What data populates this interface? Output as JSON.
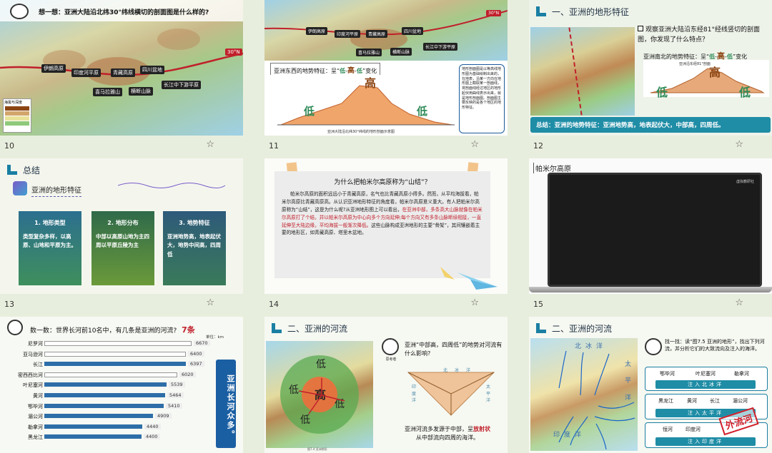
{
  "slides": [
    {
      "num": "10",
      "title": "想一想：亚洲大陆沿北纬30°纬线横切的剖面图是什么样的?",
      "lat": "30°N",
      "labels": [
        "伊朗高原",
        "印度河平原",
        "青藏高原",
        "四川盆地",
        "喜马拉雅山",
        "横断山脉",
        "长江中下游平原"
      ],
      "legend_title": "海拔与深度"
    },
    {
      "num": "11",
      "lat": "30°N",
      "labels": [
        "伊朗高原",
        "印度河平原",
        "青藏高原",
        "四川盆地",
        "喜马拉雅山",
        "横断山脉",
        "长江中下游平原"
      ],
      "feature_prefix": "亚洲东西的地势特征：呈“",
      "feature_low1": "低",
      "feature_mid": "高",
      "feature_low2": "低",
      "feature_suffix": "”变化",
      "profile_high": "高",
      "profile_low_left": "低",
      "profile_low_right": "低",
      "caption": "亚洲大陆沿北纬30°纬线的地形剖面示意图",
      "note": "地形剖面图是以等高线地形图为基础绘制出来的，在地表，沿某一方向在地形图上截取某一剖面线，将剖面线经过地区的地形起伏用曲线表示出来，就是地形剖面图。剖面图主要反映的是各个地区的地形特征。"
    },
    {
      "num": "12",
      "section": "一、亚洲的地形特征",
      "question": "观察亚洲大陆沿东经81°经线竖切的剖面图，你发现了什么特点？",
      "feature_prefix": "亚洲南北的地势特征：呈“",
      "feature_low1": "低",
      "feature_mid": "高",
      "feature_low2": "低",
      "feature_suffix": "”变化",
      "profile_title": "亚洲沿东经81°剖面",
      "profile_high": "高",
      "profile_low_left": "低",
      "profile_low_right": "低",
      "summary": "总结：亚洲的地势特征：亚洲地势高，地表起伏大，中部高，四周低。"
    },
    {
      "num": "13",
      "section": "总结",
      "subtitle": "亚洲的地形特征",
      "cards": [
        {
          "title": "1. 地形类型",
          "body": "类型复杂多样，以高原、山地和平原为主。"
        },
        {
          "title": "2. 地形分布",
          "body": "中部以高原山地为主四周以平原丘陵为主"
        },
        {
          "title": "3. 地势特征",
          "body": "亚洲地势高，地表起伏大，地势中间高，四周低"
        }
      ]
    },
    {
      "num": "14",
      "title": "为什么把帕米尔高原称为“山结”？",
      "para1": "帕米尔高原的面积远远小于青藏高原，名气也比青藏高原小得多。然而，从平均海拔看，帕米尔高原比青藏高原高。从认识亚洲地形特征的角度看，帕米尔高原意义重大。有人把帕米尔高原称为“山结”，这是为什么呢?从亚洲地形图上可以看出，",
      "para_red": "在亚洲中部，多条高大山脉就像在帕米尔高原打了个结，并以帕米尔高原为中心向多个方向延伸;每个方向又有多条山脉断续相接，一直延伸至大陆边缘，平均海拔一般渐次降低。",
      "para2": "这些山脉构成亚洲地形的主要“骨架”，其间镶嵌着主要的地形区，如青藏高原、塔里木盆地。"
    },
    {
      "num": "15",
      "title": "帕米尔高原",
      "screen_text": "虚拟教研社"
    },
    {
      "num": "16",
      "title": "数一数：世界长河前10名中，有几条是亚洲的河流?",
      "answer": "7条",
      "unit": "单位：km",
      "side": "亚洲长河众多。",
      "rivers": [
        {
          "name": "尼罗河",
          "value": 6670,
          "asia": false
        },
        {
          "name": "亚马逊河",
          "value": 6400,
          "asia": false
        },
        {
          "name": "长江",
          "value": 6397,
          "asia": true
        },
        {
          "name": "密西西比河",
          "value": 6020,
          "asia": false
        },
        {
          "name": "叶尼塞河",
          "value": 5539,
          "asia": true
        },
        {
          "name": "黄河",
          "value": 5464,
          "asia": true
        },
        {
          "name": "鄂毕河",
          "value": 5410,
          "asia": true
        },
        {
          "name": "湄公河",
          "value": 4909,
          "asia": true
        },
        {
          "name": "勒拿河",
          "value": 4440,
          "asia": true
        },
        {
          "name": "黑龙江",
          "value": 4400,
          "asia": true
        }
      ],
      "max": 6670
    },
    {
      "num": "17",
      "section": "二、亚洲的河流",
      "question": "亚洲“中部高，四周低”的地势对河流有什么影响?",
      "avatar": "思考者",
      "map_high": "高",
      "map_low": [
        "低",
        "低",
        "低",
        "低"
      ],
      "dirs": [
        "北",
        "冰",
        "洋",
        "太",
        "平",
        "洋",
        "印",
        "度",
        "洋"
      ],
      "answer_prefix": "亚洲河流多发源于中部，呈",
      "answer_red": "放射状",
      "answer_suffix": "从中部流向四周的海洋。",
      "fig": "图7.4 亚洲地形"
    },
    {
      "num": "18",
      "section": "二、亚洲的河流",
      "question": "找一找：读“图7.5 亚洲的地形”，找出下列河流，并分析它们的大致流向及注入的海洋。",
      "ocean_n": "北冰洋",
      "ocean_e1": "太",
      "ocean_e2": "平",
      "ocean_e3": "洋",
      "ocean_s": "印度洋",
      "groups": [
        {
          "rivers": [
            "鄂毕河",
            "叶尼塞河",
            "勒拿河"
          ],
          "btn": "注入北冰洋"
        },
        {
          "rivers": [
            "黑龙江",
            "黄河",
            "长江",
            "湄公河"
          ],
          "btn": "注入太平洋"
        },
        {
          "rivers": [
            "恒河",
            "印度河"
          ],
          "btn": "注入印度洋"
        }
      ],
      "stamp": "外流河"
    }
  ],
  "colors": {
    "accent": "#1f8da6",
    "red": "#c0202b",
    "dark": "#222222"
  }
}
